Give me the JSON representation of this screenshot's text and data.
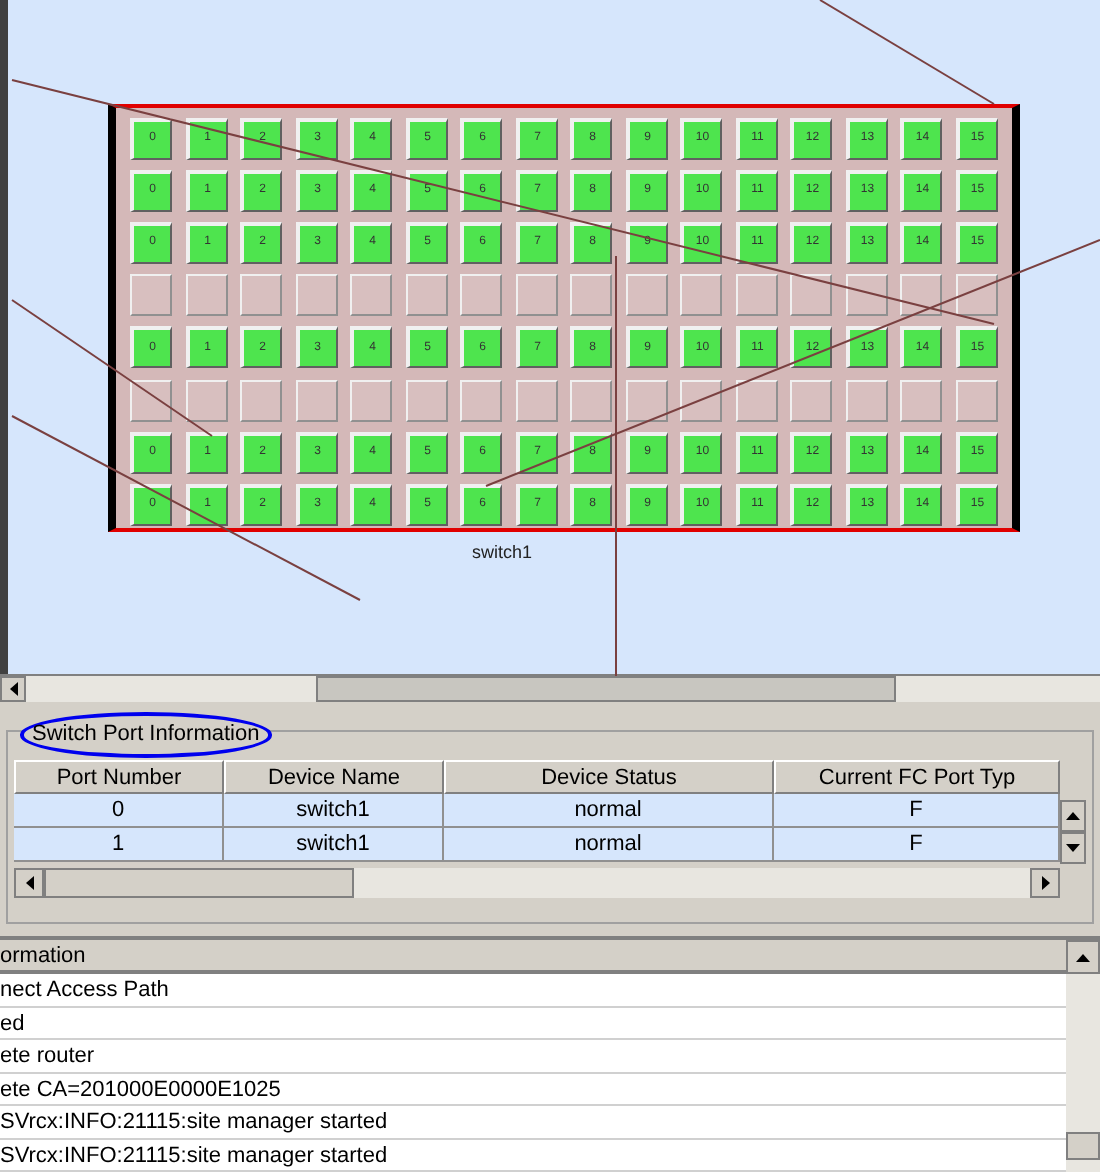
{
  "switch": {
    "name": "switch1",
    "port_rows": [
      {
        "populated": true,
        "ports": [
          "0",
          "1",
          "2",
          "3",
          "4",
          "5",
          "6",
          "7",
          "8",
          "9",
          "10",
          "11",
          "12",
          "13",
          "14",
          "15"
        ]
      },
      {
        "populated": true,
        "ports": [
          "0",
          "1",
          "2",
          "3",
          "4",
          "5",
          "6",
          "7",
          "8",
          "9",
          "10",
          "11",
          "12",
          "13",
          "14",
          "15"
        ]
      },
      {
        "populated": true,
        "ports": [
          "0",
          "1",
          "2",
          "3",
          "4",
          "5",
          "6",
          "7",
          "8",
          "9",
          "10",
          "11",
          "12",
          "13",
          "14",
          "15"
        ]
      },
      {
        "populated": false,
        "ports": []
      },
      {
        "populated": true,
        "ports": [
          "0",
          "1",
          "2",
          "3",
          "4",
          "5",
          "6",
          "7",
          "8",
          "9",
          "10",
          "11",
          "12",
          "13",
          "14",
          "15"
        ]
      },
      {
        "populated": false,
        "ports": []
      },
      {
        "populated": true,
        "ports": [
          "0",
          "1",
          "2",
          "3",
          "4",
          "5",
          "6",
          "7",
          "8",
          "9",
          "10",
          "11",
          "12",
          "13",
          "14",
          "15"
        ]
      },
      {
        "populated": true,
        "ports": [
          "0",
          "1",
          "2",
          "3",
          "4",
          "5",
          "6",
          "7",
          "8",
          "9",
          "10",
          "11",
          "12",
          "13",
          "14",
          "15"
        ]
      }
    ]
  },
  "port_panel": {
    "title": "Switch Port Information",
    "table": {
      "columns": [
        "Port Number",
        "Device Name",
        "Device Status",
        "Current FC Port Typ"
      ],
      "rows": [
        [
          "0",
          "switch1",
          "normal",
          "F"
        ],
        [
          "1",
          "switch1",
          "normal",
          "F"
        ]
      ]
    }
  },
  "log": {
    "column": "ormation",
    "rows": [
      "nect Access Path",
      "ed",
      "ete router",
      "ete CA=201000E0000E1025",
      "SVrcx:INFO:21115:site manager started",
      "SVrcx:INFO:21115:site manager started"
    ]
  }
}
